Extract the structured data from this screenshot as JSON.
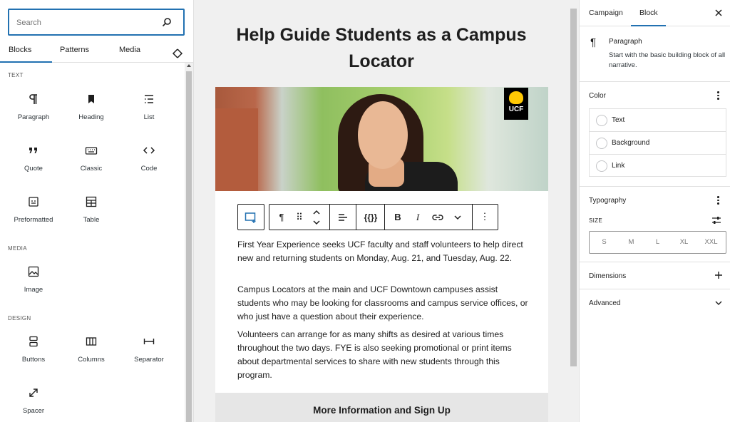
{
  "inserter": {
    "search_placeholder": "Search",
    "tabs": [
      "Blocks",
      "Patterns",
      "Media"
    ],
    "categories": {
      "text": "TEXT",
      "media": "MEDIA",
      "design": "DESIGN"
    },
    "blocks": {
      "paragraph": "Paragraph",
      "heading": "Heading",
      "list": "List",
      "quote": "Quote",
      "classic": "Classic",
      "code": "Code",
      "preformatted": "Preformatted",
      "table": "Table",
      "image": "Image",
      "buttons": "Buttons",
      "columns": "Columns",
      "separator": "Separator",
      "spacer": "Spacer"
    }
  },
  "post": {
    "title": "Help Guide Students as a Campus Locator",
    "logo_text": "UCF",
    "paragraphs": [
      "First Year Experience seeks UCF faculty and staff volunteers to help direct new and returning students on Monday, Aug. 21, and Tuesday, Aug. 22.",
      "Campus Locators at the main and UCF Downtown campuses assist students who may be looking for classrooms and campus service offices, or who just have a question about their experience.",
      "Volunteers can arrange for as many shifts as desired at various times throughout the two days. FYE is also seeking promotional or print items about departmental services to share with new students through this program."
    ],
    "more_heading": "More Information and Sign Up"
  },
  "toolbar": {
    "variable_label": "{{}}",
    "bold": "B",
    "italic": "I"
  },
  "sidebar": {
    "tabs": [
      "Campaign",
      "Block"
    ],
    "block_card": {
      "title": "Paragraph",
      "description": "Start with the basic building block of all narrative."
    },
    "color": {
      "heading": "Color",
      "items": [
        "Text",
        "Background",
        "Link"
      ]
    },
    "typography": {
      "heading": "Typography",
      "size_label": "SIZE",
      "sizes": [
        "S",
        "M",
        "L",
        "XL",
        "XXL"
      ]
    },
    "dimensions": "Dimensions",
    "advanced": "Advanced"
  },
  "colors": {
    "accent": "#2271b1",
    "ucf_gold": "#ffc904"
  }
}
